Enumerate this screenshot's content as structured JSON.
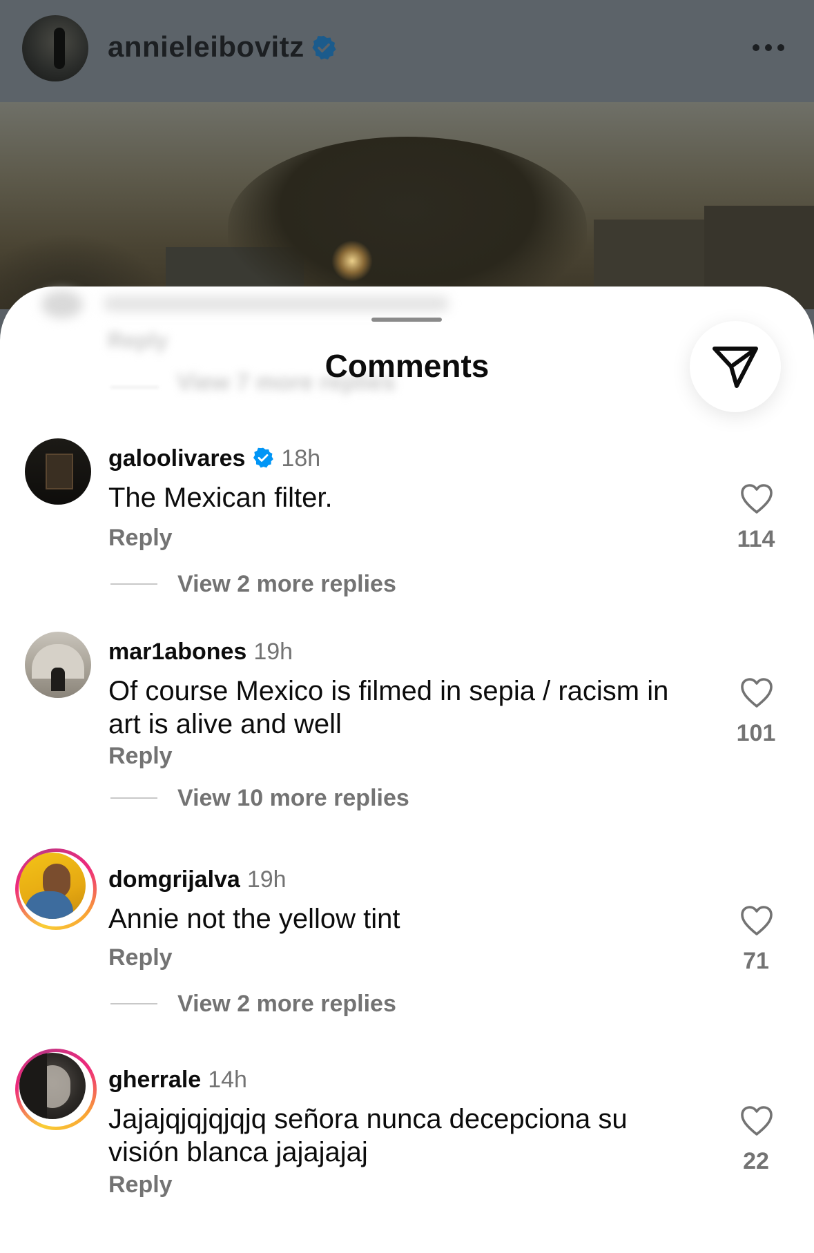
{
  "post": {
    "username": "annieleibovitz",
    "verified_icon": "verified-badge-icon",
    "more_icon": "more-horizontal-icon"
  },
  "sheet": {
    "ghost_reply": "Reply",
    "ghost_view": "View 7 more replies",
    "title": "Comments",
    "share_icon": "send-icon"
  },
  "comments": [
    {
      "username": "galoolivares",
      "verified": true,
      "time": "18h",
      "text": "The Mexican filter.",
      "reply_label": "Reply",
      "likes": "114",
      "view_replies": "View 2 more replies"
    },
    {
      "username": "mar1abones",
      "verified": false,
      "time": "19h",
      "text": "Of course Mexico is filmed in sepia / racism in art is alive and well",
      "reply_label": "Reply",
      "likes": "101",
      "view_replies": "View 10 more replies"
    },
    {
      "username": "domgrijalva",
      "verified": false,
      "time": "19h",
      "text": "Annie not the yellow tint",
      "reply_label": "Reply",
      "likes": "71",
      "view_replies": "View 2 more replies"
    },
    {
      "username": "gherrale",
      "verified": false,
      "time": "14h",
      "text": "Jajajqjqjqjqjq señora nunca decepciona su visión blanca jajajajaj",
      "reply_label": "Reply",
      "likes": "22"
    }
  ],
  "colors": {
    "verified_blue": "#0095f6",
    "secondary_text": "#737373",
    "story_ring": "#ee2a7b"
  }
}
